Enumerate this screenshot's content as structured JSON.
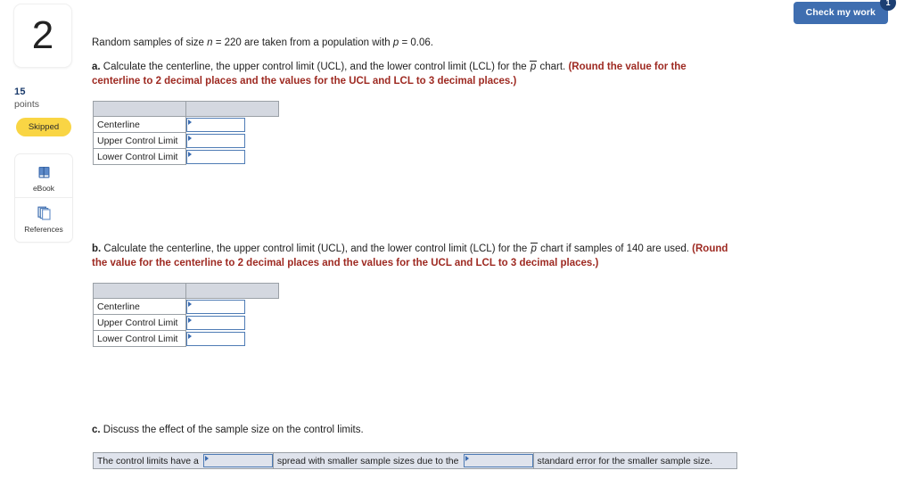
{
  "question": {
    "number": "2",
    "points_value": "15",
    "points_label": "points",
    "status": "Skipped"
  },
  "resources": {
    "items": [
      {
        "label": "eBook",
        "icon": "book-icon"
      },
      {
        "label": "References",
        "icon": "pages-icon"
      }
    ]
  },
  "toolbar": {
    "check_work_label": "Check my work",
    "check_work_badge": "1"
  },
  "content": {
    "intro": {
      "prefix": "Random samples of size ",
      "var_n": "n",
      "eq_n": " = 220 are taken from a population with ",
      "var_p": "p",
      "eq_p": " = 0.06."
    },
    "part_a": {
      "label": "a.",
      "body_1": " Calculate the centerline, the upper control limit (UCL), and the lower control limit (LCL) for the ",
      "pbar": "p",
      "body_2": " chart. ",
      "instruction": "(Round the value for the centerline to 2 decimal places and the values for the UCL and LCL to 3 decimal places.)"
    },
    "part_b": {
      "label": "b.",
      "body_1": " Calculate the centerline, the upper control limit (UCL), and the lower control limit (LCL) for the ",
      "pbar": "p",
      "body_2": " chart if samples of 140 are used. ",
      "instruction": "(Round the value for the centerline to 2 decimal places and the values for the UCL and LCL to 3 decimal places.)"
    },
    "part_c": {
      "label": "c.",
      "body": " Discuss the effect of the sample size on the control limits."
    }
  },
  "table_a": {
    "rows": [
      {
        "label": "Centerline",
        "value": ""
      },
      {
        "label": "Upper Control Limit",
        "value": ""
      },
      {
        "label": "Lower Control Limit",
        "value": ""
      }
    ]
  },
  "table_b": {
    "rows": [
      {
        "label": "Centerline",
        "value": ""
      },
      {
        "label": "Upper Control Limit",
        "value": ""
      },
      {
        "label": "Lower Control Limit",
        "value": ""
      }
    ]
  },
  "part_c_row": {
    "segment_1": "The control limits have a",
    "dropdown_1_value": "",
    "segment_2": "spread with smaller sample sizes due to the",
    "dropdown_2_value": "",
    "segment_3": "standard error for the smaller sample size."
  },
  "colors": {
    "accent_blue": "#3f6eb0",
    "badge_navy": "#1c3f73",
    "instruction_red": "#9e2a22",
    "status_yellow": "#f9d544",
    "table_header_gray": "#d4d8e0",
    "input_border_blue": "#4f7cb5",
    "row_background": "#dfe3ec"
  }
}
